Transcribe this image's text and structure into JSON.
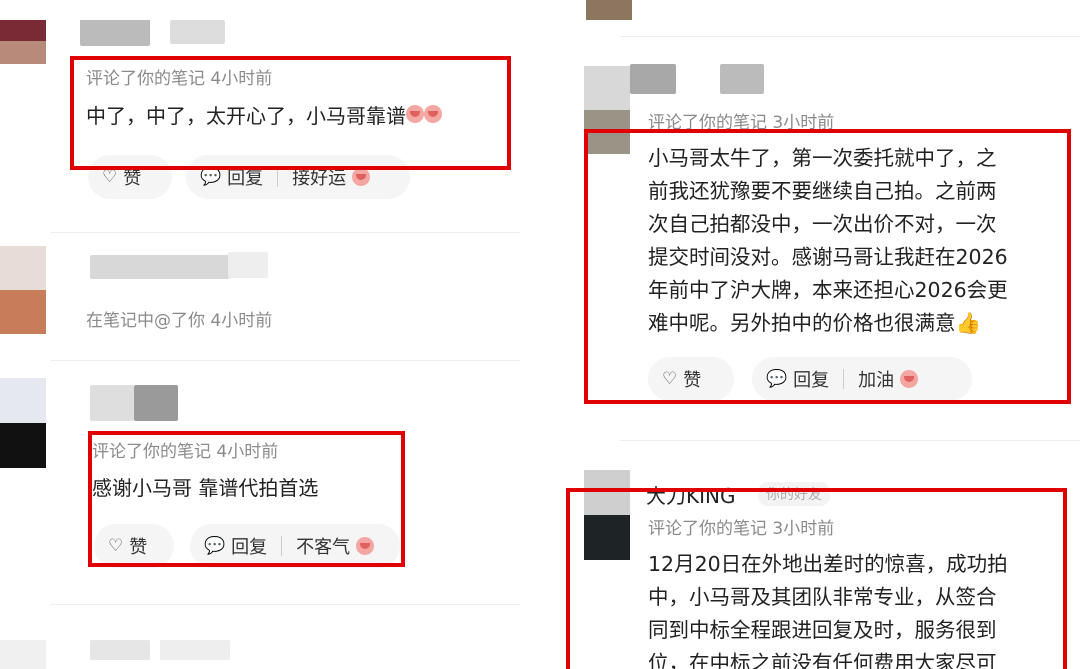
{
  "left": {
    "c1": {
      "meta": "评论了你的笔记  4小时前",
      "text": "中了，中了，太开心了，小马哥靠谱",
      "actions": {
        "like": "赞",
        "reply": "回复",
        "quick": "接好运"
      }
    },
    "c2": {
      "meta": "在笔记中@了你  4小时前"
    },
    "c3": {
      "meta": "评论了你的笔记  4小时前",
      "text": "感谢小马哥 靠谱代拍首选",
      "actions": {
        "like": "赞",
        "reply": "回复",
        "quick": "不客气"
      }
    }
  },
  "right": {
    "c1": {
      "meta": "评论了你的笔记  3小时前",
      "lines": [
        "小马哥太牛了，第一次委托就中了，之",
        "前我还犹豫要不要继续自己拍。之前两",
        "次自己拍都没中，一次出价不对，一次",
        "提交时间没对。感谢马哥让我赶在2026",
        "年前中了沪大牌，本来还担心2026会更",
        "难中呢。另外拍中的价格也很满意👍"
      ],
      "actions": {
        "like": "赞",
        "reply": "回复",
        "quick": "加油"
      }
    },
    "c2": {
      "name": "大刀KING",
      "tag": "你的好友",
      "meta": "评论了你的笔记  3小时前",
      "lines": [
        "12月20日在外地出差时的惊喜，成功拍",
        "中，小马哥及其团队非常专业，从签合",
        "同到中标全程跟进回复及时，服务很到",
        "位，在中标之前没有任何费用大家尽可"
      ]
    }
  }
}
